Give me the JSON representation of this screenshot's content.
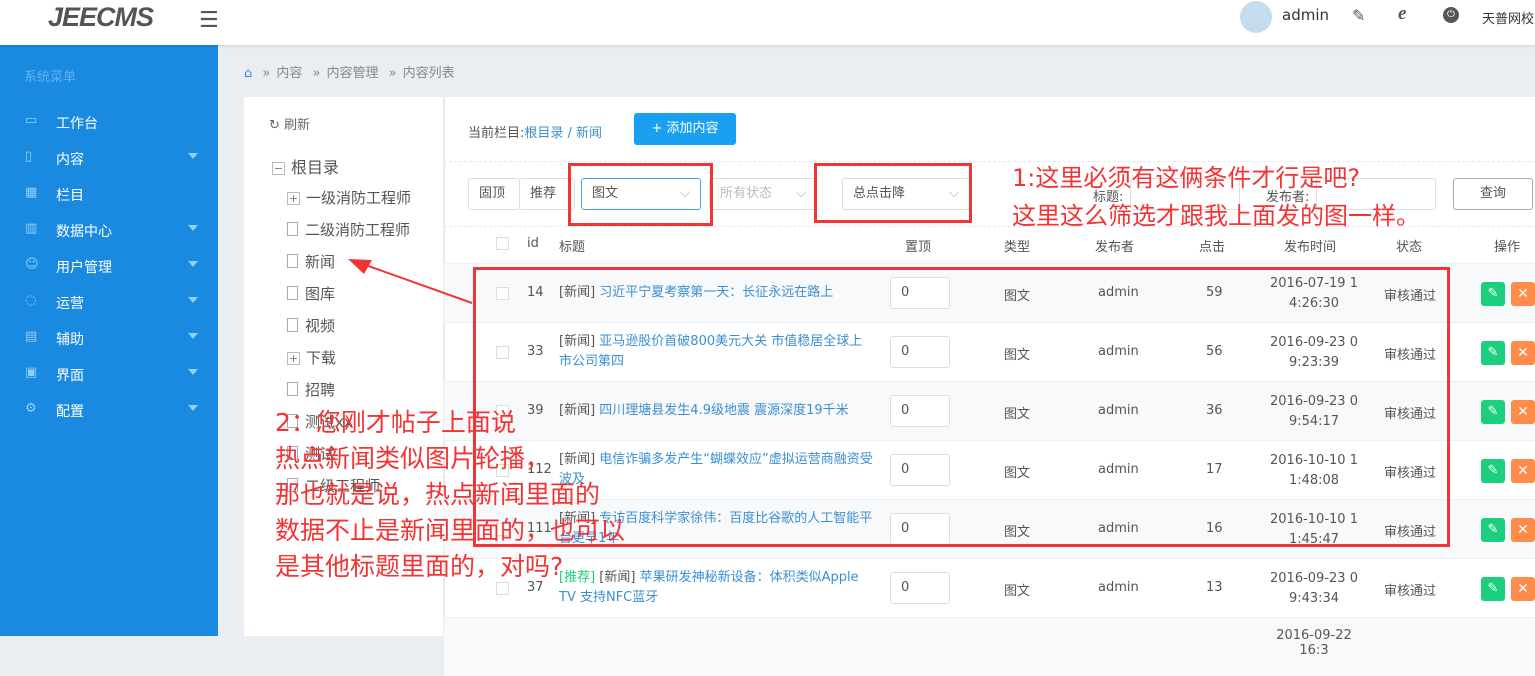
{
  "header": {
    "logo": "JEECMS",
    "user": "admin",
    "org": "天普网校"
  },
  "sidebar": {
    "title": "系统菜单",
    "items": [
      {
        "label": "工作台",
        "icon": "monitor-icon"
      },
      {
        "label": "内容",
        "icon": "file-icon",
        "caret": true
      },
      {
        "label": "栏目",
        "icon": "grid-icon"
      },
      {
        "label": "数据中心",
        "icon": "chart-icon",
        "caret": true
      },
      {
        "label": "用户管理",
        "icon": "user-icon",
        "caret": true
      },
      {
        "label": "运营",
        "icon": "shield-icon",
        "caret": true
      },
      {
        "label": "辅助",
        "icon": "box-icon",
        "caret": true
      },
      {
        "label": "界面",
        "icon": "layout-icon",
        "caret": true
      },
      {
        "label": "配置",
        "icon": "gear-icon",
        "caret": true
      }
    ]
  },
  "breadcrumb": [
    "内容",
    "内容管理",
    "内容列表"
  ],
  "tree": {
    "refresh": "刷新",
    "root": "根目录",
    "items": [
      {
        "label": "一级消防工程师",
        "expandable": true
      },
      {
        "label": "二级消防工程师"
      },
      {
        "label": "新闻"
      },
      {
        "label": "图库"
      },
      {
        "label": "视频"
      },
      {
        "label": "下载",
        "expandable": true
      },
      {
        "label": "招聘"
      },
      {
        "label": "测试xx"
      },
      {
        "label": "测试"
      },
      {
        "label": "二级工程师"
      }
    ]
  },
  "main": {
    "current_label": "当前栏目:",
    "current_path": "根目录 / 新闻",
    "add_button": "+ 添加内容",
    "filters": {
      "top": "固顶",
      "recommend": "推荐",
      "type": "图文",
      "status": "所有状态",
      "sort": "总点击降",
      "title_label": "标题:",
      "author_label": "发布者:",
      "query": "查询"
    },
    "columns": [
      "id",
      "标题",
      "置顶",
      "类型",
      "发布者",
      "点击",
      "发布时间",
      "状态",
      "操作"
    ],
    "rows": [
      {
        "id": "14",
        "tag": "[新闻]",
        "title": "习近平宁夏考察第一天：长征永远在路上",
        "top": "0",
        "type": "图文",
        "author": "admin",
        "clicks": "59",
        "time": "2016-07-19 14:26:30",
        "status": "审核通过"
      },
      {
        "id": "33",
        "tag": "[新闻]",
        "title": "亚马逊股价首破800美元大关 市值稳居全球上市公司第四",
        "top": "0",
        "type": "图文",
        "author": "admin",
        "clicks": "56",
        "time": "2016-09-23 09:23:39",
        "status": "审核通过"
      },
      {
        "id": "39",
        "tag": "[新闻]",
        "title": "四川理塘县发生4.9级地震 震源深度19千米",
        "top": "0",
        "type": "图文",
        "author": "admin",
        "clicks": "36",
        "time": "2016-09-23 09:54:17",
        "status": "审核通过"
      },
      {
        "id": "112",
        "tag": "[新闻]",
        "title": "电信诈骗多发产生“蝴蝶效应”虚拟运营商融资受波及",
        "top": "0",
        "type": "图文",
        "author": "admin",
        "clicks": "17",
        "time": "2016-10-10 11:48:08",
        "status": "审核通过"
      },
      {
        "id": "111",
        "tag": "[新闻]",
        "title": "专访百度科学家徐伟：百度比谷歌的人工智能平台更早1年",
        "top": "0",
        "type": "图文",
        "author": "admin",
        "clicks": "16",
        "time": "2016-10-10 11:45:47",
        "status": "审核通过"
      },
      {
        "id": "37",
        "badge": "[推荐]",
        "tag": "[新闻]",
        "title": "苹果研发神秘新设备：体积类似Apple TV 支持NFC蓝牙",
        "top": "0",
        "type": "图文",
        "author": "admin",
        "clicks": "13",
        "time": "2016-09-23 09:43:34",
        "status": "审核通过"
      },
      {
        "time": "2016-09-22 16:3"
      }
    ]
  },
  "annotations": {
    "note1_line1": "1:这里必须有这俩条件才行是吧?",
    "note1_line2": "这里这么筛选才跟我上面发的图一样。",
    "note2": [
      "2：您刚才帖子上面说",
      "热点新闻类似图片轮播，",
      "那也就是说，热点新闻里面的",
      "数据不止是新闻里面的，也可以",
      "是其他标题里面的，对吗?"
    ]
  },
  "colors": {
    "sidebar": "#1a8ae0",
    "accent": "#1aa0f0",
    "annotation": "#f23434",
    "edit": "#1ccf7f",
    "delete": "#ff8c4a"
  }
}
